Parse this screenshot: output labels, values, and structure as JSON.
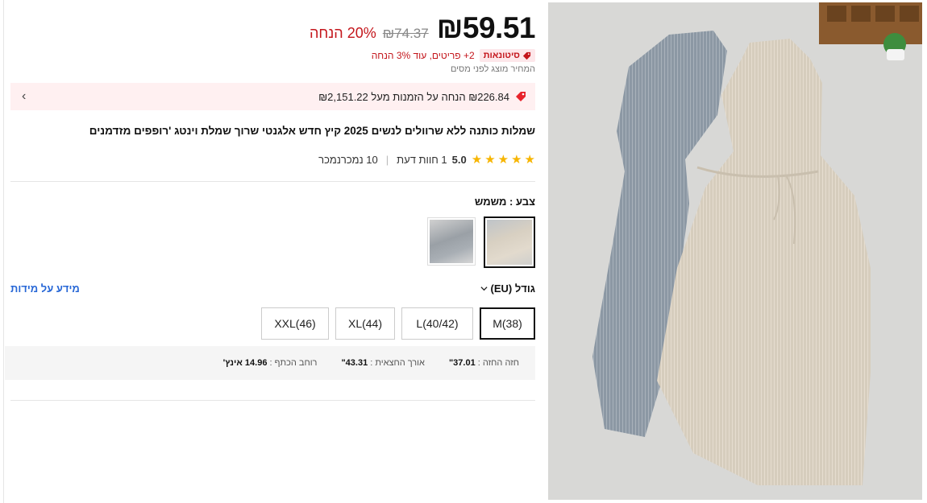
{
  "price": {
    "current": "₪59.51",
    "original": "₪74.37",
    "discount": "20% הנחה"
  },
  "promo": {
    "badge": "סיטונאות",
    "text": "2+ פריטים, עוד 3% הנחה"
  },
  "tax_note": "המחיר מוצג לפני מסים",
  "coupon": {
    "text": "₪226.84 הנחה על הזמנות מעל ₪2,151.22",
    "chevron": "›"
  },
  "product_title": "שמלות כותנה ללא שרוולים לנשים 2025 קיץ חדש אלגנטי שרוך שמלת וינטג 'רופפים מזדמנים",
  "rating": {
    "value": "5.0",
    "reviews": "1 חוות דעת",
    "sold": "10 נמכרנמכר",
    "stars": 5
  },
  "color": {
    "label": "צבע : משמש",
    "options": [
      {
        "name": "משמש",
        "tone": "#d8d0c2"
      },
      {
        "name": "אפור",
        "tone": "#9aa0a6"
      }
    ]
  },
  "size": {
    "label": "גודל (EU)",
    "guide_link": "מידע על מידות",
    "options": [
      "M(38)",
      "L(40/42)",
      "XL(44)",
      "XXL(46)"
    ],
    "selected": "M(38)"
  },
  "measurements": {
    "bust": "חזה החזה : ",
    "bust_value": "37.01\"",
    "length": "אורך החצאית : ",
    "length_value": "43.31\"",
    "shoulder": "רוחב הכתף : ",
    "shoulder_value": "14.96 אינץ'"
  },
  "icons": {
    "tag": "tag-icon",
    "coupon": "coupon-icon",
    "chevron_down": "chevron-down-icon"
  }
}
